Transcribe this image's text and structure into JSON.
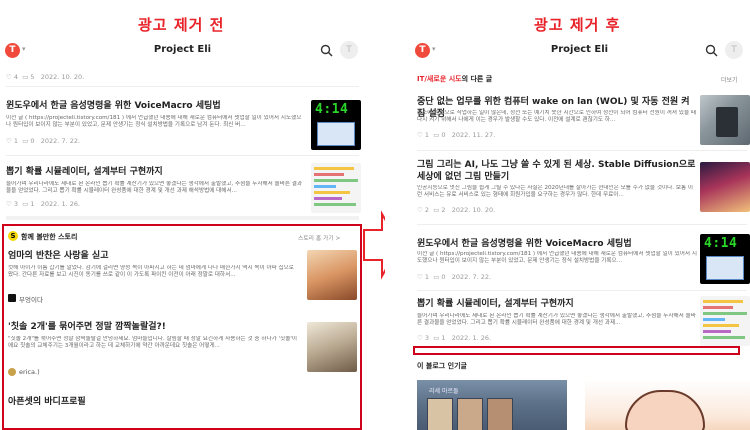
{
  "captions": {
    "before": "광고 제거 전",
    "after": "광고 제거 후"
  },
  "topbar": {
    "logo_letter": "T",
    "blog_title": "Project Eli",
    "avatar_letter": "T"
  },
  "left": {
    "top_meta": {
      "likes": "4",
      "comments": "5",
      "date": "2022. 10. 20."
    },
    "posts": [
      {
        "title": "윈도우에서 한글 음성명령을 위한 VoiceMacro 세팅법",
        "excerpt": "이전 글 ( https://projecteli.tistory.com/181 ) 에서 언급했던 내용에 대해 새로운 컴퓨터에서 셋업할 일이 있어서 시도했으나 원터입이 보이지 않는 부분이 있었고, 문제 안생기는 정식 설치방법을 기록으로 남겨 둔다. 최신 버...",
        "likes": "1",
        "comments": "0",
        "date": "2022. 7. 22."
      },
      {
        "title": "뽑기 확률 시뮬레이터, 설계부터 구현까지",
        "excerpt": "들어가며 우리나라에도 제대로 된 온라인 뽑기 확률 계산기가 있으면 좋겠다는 생각에서 출발했고, 추첨을 두자해서 올바른 결과물을 얻었었다. 그리고 뽑기 확률 시뮬레이터 완성품에 대한 경계 및 개선 과제 해석방법에 대해서...",
        "likes": "3",
        "comments": "1",
        "date": "2022. 1. 26."
      }
    ],
    "ad": {
      "header": "함께 볼만한 스토리",
      "more": "스토리 홈 가기 >",
      "items": [
        {
          "title": "엄마의 반찬은 사랑을 싣고",
          "excerpt": "컷해 아이가 이름 갑기를 알었다. 감기에 걸리면 양성 목이 아파지고 하는 데 엄마에게 나나 매한가지 역시 목이 아파 집으로 왔다. 간다른 자료를 보고 시진이 동기를 쓰로 같이 이 가도록 파이킨 이전이 아래 정말로 대하서...",
          "author": "부엉이다"
        },
        {
          "title": "'칫솔 2개'를 묶어주면 정말 깜짝놀랄걸?!",
          "excerpt": "\"칫솔 2개\"를 묶어주면 정말 깜짝놀랄걸 안녕하세요. 엄마들입니다. 살림할 때 정말 요긴하게 사용하는 것 중 하나가 '칫솔'이에요 칫솔의 교체주기는 3개월이라고 하는 데 교체하기에 약간 아까운데요 칫솔은 어떻게...",
          "author": "erica.)"
        },
        {
          "title": "아픈셋의 바디프로필",
          "excerpt": "",
          "author": ""
        }
      ]
    }
  },
  "right": {
    "section_prefix": "IT/새로운 시도",
    "section_suffix": "의 다른 글",
    "section_more": "더보기",
    "posts": [
      {
        "title": "중단 없는 업무를 위한 컴퓨터 wake on lan (WOL) 및 자동 전원 켜짐 설정",
        "excerpt": "불소에 원격으로 작업하는 일이 많은데, 정전 또는 예기치 못한 시간으로 인하여 정전이 되어 컴퓨터 전원이 꺼져 있을 때 다시 켜기 위해서 나에게 이는 경우가 발생할 수도 있다. 이전에 설계로 괜찮기도 하...",
        "likes": "1",
        "comments": "0",
        "date": "2022. 11. 27."
      },
      {
        "title": "그림 그리는 AI, 나도 그냥 쓸 수 있게 된 세상. Stable Diffusion으로 세상에 없던 그림 만들기",
        "excerpt": "인공지능으로 멋진 그림을 쉽게 그릴 수 있다는 사실은 2020년대를 살아가는 현대인은 모를 수가 없을 것이다. 보통 이런 서비스는 유료 서비스로 있는 형태에 회원가입을 요구하는 경우가 많다. 한데 무료이...",
        "likes": "2",
        "comments": "2",
        "date": "2022. 10. 20."
      },
      {
        "title": "윈도우에서 한글 음성명령을 위한 VoiceMacro 세팅법",
        "excerpt": "이전 글 ( https://projecteli.tistory.com/181 ) 에서 언급했던 내용에 대해 새로운 컴퓨터에서 셋업할 일이 있어서 시도했으나 원터입이 보이지 않는 부분이 있었고, 문제 안생기는 정식 설치방법을 기록으...",
        "likes": "1",
        "comments": "0",
        "date": "2022. 7. 22."
      },
      {
        "title": "뽑기 확률 시뮬레이터, 설계부터 구현까지",
        "excerpt": "들어가며 우리나라에도 제대로 된 온라인 뽑기 확률 계산기가 있으면 좋겠다는 생각에서 출발했고, 추첨을 두자해서 올바른 결과물을 얻었었다. 그리고 뽑기 확률 시뮬레이터 완성품에 대한 경계 및 개선 과제...",
        "likes": "3",
        "comments": "1",
        "date": "2022. 1. 26."
      }
    ],
    "popular_title": "이 블로그 인기글",
    "popular_img_label": "리세 마르돌"
  },
  "colors": {
    "caption": "#e8232a",
    "ad_border": "#d0021b",
    "logo": "#f04a3c",
    "link_red": "#e8232a"
  }
}
